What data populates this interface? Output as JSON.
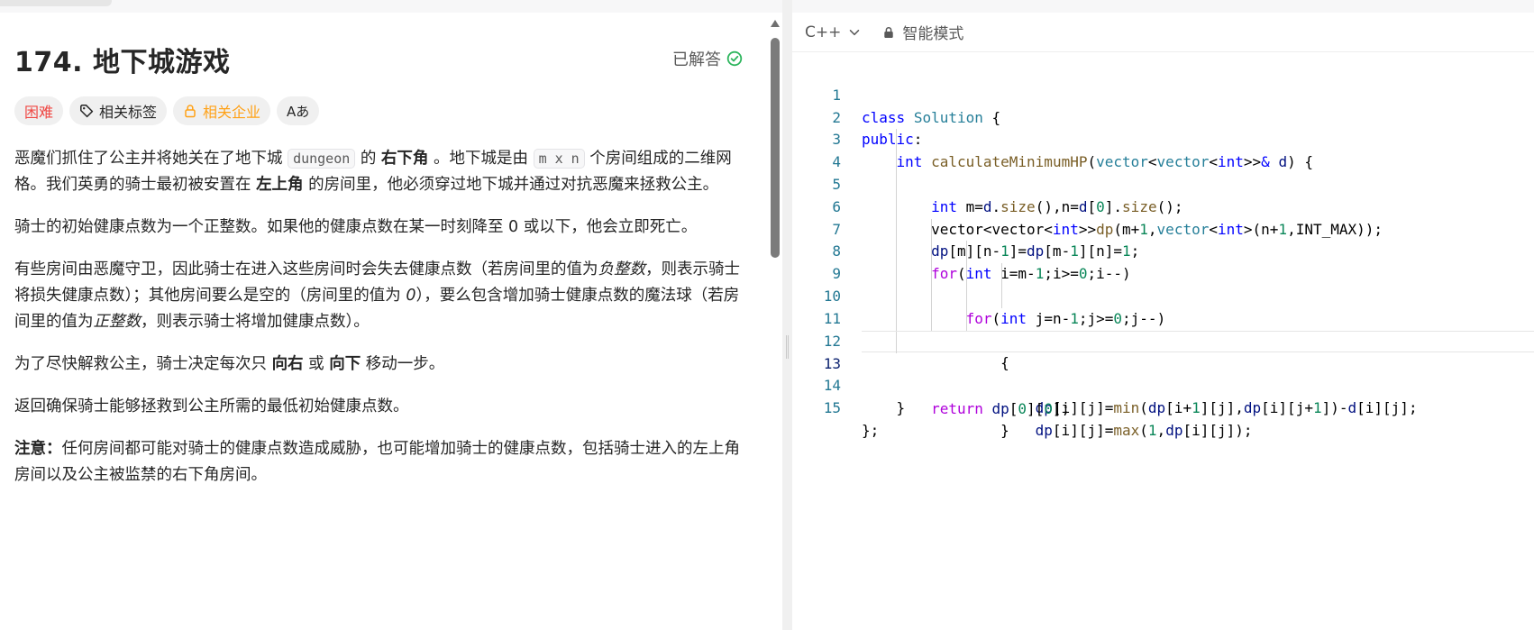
{
  "problem": {
    "title": "174. 地下城游戏",
    "solved_label": "已解答",
    "tags": {
      "difficulty": "困难",
      "related_tags": "相关标签",
      "related_companies": "相关企业",
      "font_toggle": "Aあ"
    },
    "description": {
      "p1_a": "恶魔们抓住了公主并将她关在了地下城 ",
      "p1_code1": "dungeon",
      "p1_b": " 的 ",
      "p1_bold1": "右下角",
      "p1_c": " 。地下城是由 ",
      "p1_code2": "m x n",
      "p1_d": " 个房间组成的二维网格。我们英勇的骑士最初被安置在 ",
      "p1_bold2": "左上角",
      "p1_e": " 的房间里，他必须穿过地下城并通过对抗恶魔来拯救公主。",
      "p2": "骑士的初始健康点数为一个正整数。如果他的健康点数在某一时刻降至 0 或以下，他会立即死亡。",
      "p3_a": "有些房间由恶魔守卫，因此骑士在进入这些房间时会失去健康点数（若房间里的值为",
      "p3_i1": "负整数",
      "p3_b": "，则表示骑士将损失健康点数）；其他房间要么是空的（房间里的值为 ",
      "p3_i2": "0",
      "p3_c": "），要么包含增加骑士健康点数的魔法球（若房间里的值为",
      "p3_i3": "正整数",
      "p3_d": "，则表示骑士将增加健康点数）。",
      "p4_a": "为了尽快解救公主，骑士决定每次只 ",
      "p4_bold1": "向右",
      "p4_b": " 或 ",
      "p4_bold2": "向下",
      "p4_c": " 移动一步。",
      "p5": "返回确保骑士能够拯救到公主所需的最低初始健康点数。",
      "p6_bold": "注意：",
      "p6": "任何房间都可能对骑士的健康点数造成威胁，也可能增加骑士的健康点数，包括骑士进入的左上角房间以及公主被监禁的右下角房间。"
    }
  },
  "editor": {
    "language": "C++",
    "mode": "智能模式",
    "line_numbers": [
      "1",
      "2",
      "3",
      "4",
      "5",
      "6",
      "7",
      "8",
      "9",
      "10",
      "11",
      "12",
      "13",
      "14",
      "15"
    ],
    "current_line": 13
  },
  "colors": {
    "hard": "#ef4743",
    "company": "#ffa116",
    "solved_check": "#2db55d",
    "keyword": "#0000ff",
    "control": "#af00db",
    "type": "#267f99",
    "function": "#795e26",
    "variable": "#001080",
    "number": "#098658"
  },
  "icons": {
    "solved": "check-circle-icon",
    "tag": "tag-icon",
    "lock": "lock-icon",
    "font": "font-size-icon",
    "chevron": "chevron-down-icon"
  }
}
